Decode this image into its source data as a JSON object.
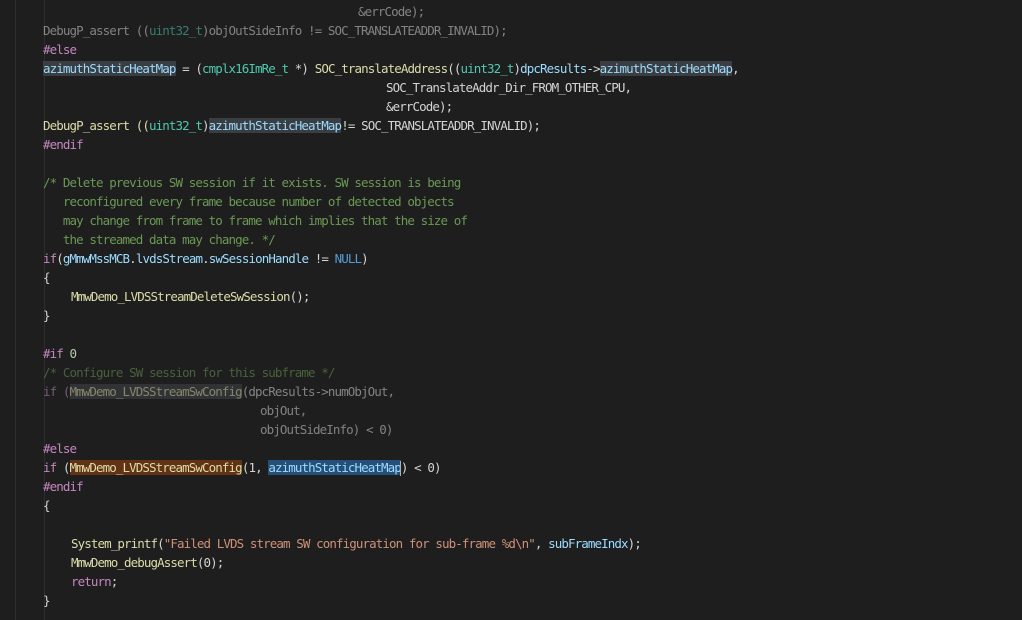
{
  "editor": {
    "language": "C",
    "theme": "dark",
    "lines": [
      {
        "indent": 315,
        "segments": [
          {
            "t": "&errCode);",
            "c": "plain"
          }
        ],
        "inactive": true
      },
      {
        "indent": 0,
        "segments": [
          {
            "t": "DebugP_assert ((",
            "c": "plain"
          },
          {
            "t": "uint32_t",
            "c": "ty"
          },
          {
            "t": ")objOutSideInfo != SOC_TRANSLATEADDR_INVALID);",
            "c": "plain"
          }
        ],
        "inactive": true
      },
      {
        "indent": 0,
        "segments": [
          {
            "t": "#else",
            "c": "pp"
          }
        ]
      },
      {
        "indent": 0,
        "segments": [
          {
            "t": "azimuthStaticHeatMap",
            "c": "var",
            "hl": "hl1"
          },
          {
            "t": " = (",
            "c": "plain"
          },
          {
            "t": "cmplx16ImRe_t",
            "c": "ty"
          },
          {
            "t": " *) ",
            "c": "plain"
          },
          {
            "t": "SOC_translateAddress",
            "c": "fn"
          },
          {
            "t": "((",
            "c": "plain"
          },
          {
            "t": "uint32_t",
            "c": "ty"
          },
          {
            "t": ")",
            "c": "plain"
          },
          {
            "t": "dpcResults",
            "c": "var"
          },
          {
            "t": "->",
            "c": "plain"
          },
          {
            "t": "azimuthStaticHeatMap",
            "c": "var",
            "hl": "hl1"
          },
          {
            "t": ",",
            "c": "plain"
          }
        ]
      },
      {
        "indent": 343,
        "segments": [
          {
            "t": "SOC_TranslateAddr_Dir_FROM_OTHER_CPU,",
            "c": "plain"
          }
        ]
      },
      {
        "indent": 343,
        "segments": [
          {
            "t": "&errCode);",
            "c": "plain"
          }
        ]
      },
      {
        "indent": 0,
        "segments": [
          {
            "t": "DebugP_assert ((",
            "c": "fn"
          },
          {
            "t": "uint32_t",
            "c": "ty"
          },
          {
            "t": ")",
            "c": "plain"
          },
          {
            "t": "azimuthStaticHeatMap",
            "c": "var",
            "hl": "hl1"
          },
          {
            "t": "!= SOC_TRANSLATEADDR_INVALID);",
            "c": "plain"
          }
        ]
      },
      {
        "indent": 0,
        "segments": [
          {
            "t": "#endif",
            "c": "pp"
          }
        ]
      },
      {
        "indent": 0,
        "segments": []
      },
      {
        "indent": 0,
        "segments": [
          {
            "t": "/* Delete previous SW session if it exists. SW session is being",
            "c": "cm"
          }
        ]
      },
      {
        "indent": 0,
        "segments": [
          {
            "t": "   reconfigured every frame because number of detected objects",
            "c": "cm"
          }
        ]
      },
      {
        "indent": 0,
        "segments": [
          {
            "t": "   may change from frame to frame which implies that the size of",
            "c": "cm"
          }
        ]
      },
      {
        "indent": 0,
        "segments": [
          {
            "t": "   the streamed data may change. */",
            "c": "cm"
          }
        ]
      },
      {
        "indent": 0,
        "segments": [
          {
            "t": "if",
            "c": "kw"
          },
          {
            "t": "(",
            "c": "plain"
          },
          {
            "t": "gMmwMssMCB",
            "c": "var"
          },
          {
            "t": ".",
            "c": "plain"
          },
          {
            "t": "lvdsStream",
            "c": "var"
          },
          {
            "t": ".",
            "c": "plain"
          },
          {
            "t": "swSessionHandle",
            "c": "var"
          },
          {
            "t": " != ",
            "c": "plain"
          },
          {
            "t": "NULL",
            "c": "con"
          },
          {
            "t": ")",
            "c": "plain"
          }
        ]
      },
      {
        "indent": 0,
        "segments": [
          {
            "t": "{",
            "c": "plain"
          }
        ]
      },
      {
        "indent": 28,
        "segments": [
          {
            "t": "MmwDemo_LVDSStreamDeleteSwSession",
            "c": "fn"
          },
          {
            "t": "();",
            "c": "plain"
          }
        ]
      },
      {
        "indent": 0,
        "segments": [
          {
            "t": "}",
            "c": "plain"
          }
        ]
      },
      {
        "indent": 0,
        "segments": []
      },
      {
        "indent": 0,
        "segments": [
          {
            "t": "#if ",
            "c": "pp"
          },
          {
            "t": "0",
            "c": "num"
          }
        ]
      },
      {
        "indent": 0,
        "segments": [
          {
            "t": "/* Configure SW session for this subframe */",
            "c": "cm"
          }
        ],
        "inactive": true
      },
      {
        "indent": 0,
        "segments": [
          {
            "t": "if (",
            "c": "kw"
          },
          {
            "t": "MmwDemo_LVDSStreamSwConfig",
            "c": "fn",
            "hl": "hlg"
          },
          {
            "t": "(dpcResults->numObjOut,",
            "c": "plain"
          }
        ],
        "inactive": true
      },
      {
        "indent": 217,
        "segments": [
          {
            "t": "objOut,",
            "c": "plain"
          }
        ],
        "inactive": true
      },
      {
        "indent": 217,
        "segments": [
          {
            "t": "objOutSideInfo) < 0)",
            "c": "plain"
          }
        ],
        "inactive": true
      },
      {
        "indent": 0,
        "segments": [
          {
            "t": "#else",
            "c": "pp"
          }
        ]
      },
      {
        "indent": 0,
        "segments": [
          {
            "t": "if",
            "c": "kw"
          },
          {
            "t": " (",
            "c": "plain"
          },
          {
            "t": "MmwDemo_LVDSStreamSwConfig",
            "c": "fn",
            "hl": "hlo"
          },
          {
            "t": "(1, ",
            "c": "plain"
          },
          {
            "t": "azimuthStaticHeatMap",
            "c": "var",
            "hl": "hl2",
            "cursor": true
          },
          {
            "t": ") < 0)",
            "c": "plain"
          }
        ]
      },
      {
        "indent": 0,
        "segments": [
          {
            "t": "#endif",
            "c": "pp"
          }
        ]
      },
      {
        "indent": 0,
        "segments": [
          {
            "t": "{",
            "c": "plain"
          }
        ]
      },
      {
        "indent": 0,
        "segments": []
      },
      {
        "indent": 28,
        "segments": [
          {
            "t": "System_printf",
            "c": "fn"
          },
          {
            "t": "(",
            "c": "plain"
          },
          {
            "t": "\"Failed LVDS stream SW configuration for sub-frame %d\\n\"",
            "c": "str"
          },
          {
            "t": ", ",
            "c": "plain"
          },
          {
            "t": "subFrameIndx",
            "c": "var"
          },
          {
            "t": ");",
            "c": "plain"
          }
        ]
      },
      {
        "indent": 28,
        "segments": [
          {
            "t": "MmwDemo_debugAssert",
            "c": "fn"
          },
          {
            "t": "(0);",
            "c": "plain"
          }
        ]
      },
      {
        "indent": 28,
        "segments": [
          {
            "t": "return",
            "c": "kw"
          },
          {
            "t": ";",
            "c": "plain"
          }
        ]
      },
      {
        "indent": 0,
        "segments": [
          {
            "t": "}",
            "c": "plain"
          }
        ]
      }
    ]
  }
}
